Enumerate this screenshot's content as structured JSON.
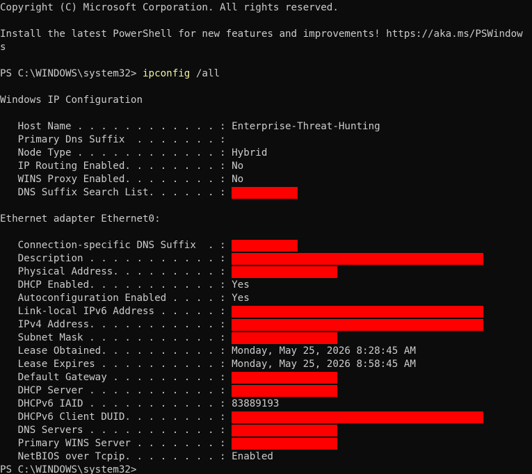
{
  "header": {
    "copyright": "Copyright (C) Microsoft Corporation. All rights reserved.",
    "install_line_1": "Install the latest PowerShell for new features and improvements! https://aka.ms/PSWindow",
    "install_line_2": "s"
  },
  "prompt": {
    "text": "PS C:\\WINDOWS\\system32> ",
    "command": "ipconfig",
    "args": " /all",
    "final": "PS C:\\WINDOWS\\system32>"
  },
  "windows_ip": {
    "title": "Windows IP Configuration",
    "rows": [
      {
        "key": "   Host Name . . . . . . . . . . . . : ",
        "value": "Enterprise-Threat-Hunting"
      },
      {
        "key": "   Primary Dns Suffix  . . . . . . . : ",
        "value": ""
      },
      {
        "key": "   Node Type . . . . . . . . . . . . : ",
        "value": "Hybrid"
      },
      {
        "key": "   IP Routing Enabled. . . . . . . . : ",
        "value": "No"
      },
      {
        "key": "   WINS Proxy Enabled. . . . . . . . : ",
        "value": "No"
      },
      {
        "key": "   DNS Suffix Search List. . . . . . : ",
        "value": "",
        "redacted": "short"
      }
    ]
  },
  "ethernet": {
    "title": "Ethernet adapter Ethernet0:",
    "rows": [
      {
        "key": "   Connection-specific DNS Suffix  . : ",
        "value": "",
        "redacted": "short"
      },
      {
        "key": "   Description . . . . . . . . . . . : ",
        "value": "",
        "redacted": "long"
      },
      {
        "key": "   Physical Address. . . . . . . . . : ",
        "value": "",
        "redacted": "medium"
      },
      {
        "key": "   DHCP Enabled. . . . . . . . . . . : ",
        "value": "Yes"
      },
      {
        "key": "   Autoconfiguration Enabled . . . . : ",
        "value": "Yes"
      },
      {
        "key": "   Link-local IPv6 Address . . . . . : ",
        "value": "",
        "redacted": "long"
      },
      {
        "key": "   IPv4 Address. . . . . . . . . . . : ",
        "value": "",
        "redacted": "long"
      },
      {
        "key": "   Subnet Mask . . . . . . . . . . . : ",
        "value": "",
        "redacted": "medium"
      },
      {
        "key": "   Lease Obtained. . . . . . . . . . : ",
        "value": "Monday, May 25, 2026 8:28:45 AM"
      },
      {
        "key": "   Lease Expires . . . . . . . . . . : ",
        "value": "Monday, May 25, 2026 8:58:45 AM"
      },
      {
        "key": "   Default Gateway . . . . . . . . . : ",
        "value": "",
        "redacted": "medium"
      },
      {
        "key": "   DHCP Server . . . . . . . . . . . : ",
        "value": "",
        "redacted": "medium"
      },
      {
        "key": "   DHCPv6 IAID . . . . . . . . . . . : ",
        "value": "83889193"
      },
      {
        "key": "   DHCPv6 Client DUID. . . . . . . . : ",
        "value": "",
        "redacted": "long"
      },
      {
        "key": "   DNS Servers . . . . . . . . . . . : ",
        "value": "",
        "redacted": "medium"
      },
      {
        "key": "   Primary WINS Server . . . . . . . : ",
        "value": "",
        "redacted": "medium"
      },
      {
        "key": "   NetBIOS over Tcpip. . . . . . . . : ",
        "value": "Enabled"
      }
    ]
  },
  "colors": {
    "background": "#0c0c0c",
    "text": "#cccccc",
    "command": "#f2f2a0",
    "redaction": "#ff0000"
  }
}
